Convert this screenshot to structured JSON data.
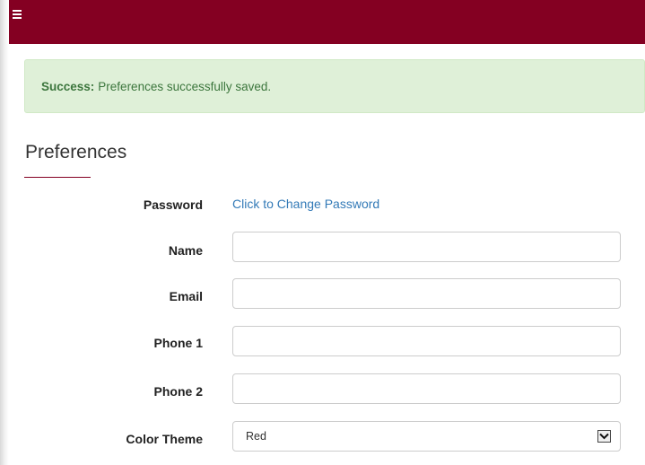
{
  "colors": {
    "topbar": "#840022",
    "accent_rule": "#840022",
    "link": "#337ab7",
    "success_bg": "#dff0d8",
    "success_text": "#3c763d"
  },
  "topbar": {
    "menu_icon": "hamburger-menu-icon"
  },
  "alert": {
    "title": "Success:",
    "message": "Preferences successfully saved."
  },
  "page": {
    "heading": "Preferences"
  },
  "form": {
    "password": {
      "label": "Password",
      "link": "Click to Change Password"
    },
    "name": {
      "label": "Name",
      "value": ""
    },
    "email": {
      "label": "Email",
      "value": ""
    },
    "phone1": {
      "label": "Phone 1",
      "value": ""
    },
    "phone2": {
      "label": "Phone 2",
      "value": ""
    },
    "color_theme": {
      "label": "Color Theme",
      "selected": "Red",
      "arrow_icon": "chevron-down-icon"
    }
  }
}
